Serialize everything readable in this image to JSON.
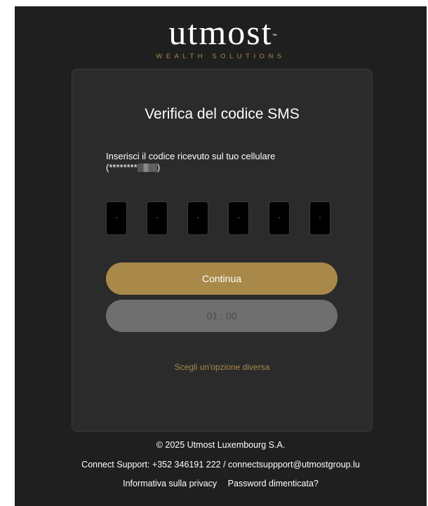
{
  "brand": {
    "name": "utmost",
    "trademark": "™",
    "tagline": "WEALTH SOLUTIONS"
  },
  "card": {
    "title": "Verifica del codice SMS",
    "instruction": "Inserisci il codice ricevuto sul tuo cellulare",
    "phone_prefix": "(********",
    "phone_suffix": ")",
    "code_boxes": [
      "-",
      "-",
      "-",
      "-",
      "-",
      "-"
    ],
    "continue_label": "Continua",
    "timer_label": "01 : 00",
    "other_option_label": "Scegli un'opzione diversa"
  },
  "footer": {
    "copyright": "© 2025 Utmost Luxembourg S.A.",
    "support": "Connect Support: +352 346191 222 / connectsuppport@utmostgroup.lu",
    "privacy_link": "Informativa sulla privacy",
    "password_link": "Password dimenticata?"
  },
  "colors": {
    "background": "#1f1f1f",
    "card": "#2b2b2b",
    "accent_gold": "#a8894a",
    "disabled_grey": "#6f6f6f"
  }
}
